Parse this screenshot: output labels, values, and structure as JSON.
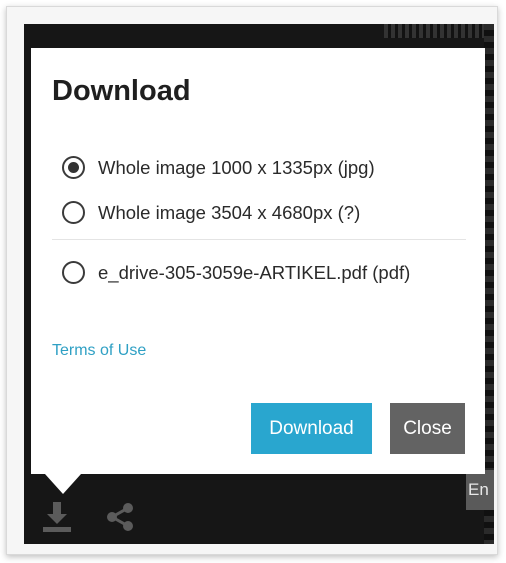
{
  "dialog": {
    "title": "Download",
    "options": [
      {
        "label": "Whole image 1000 x 1335px (jpg)",
        "checked": true
      },
      {
        "label": "Whole image 3504 x 4680px (?)",
        "checked": false
      },
      {
        "label": "e_drive-305-3059e-ARTIKEL.pdf (pdf)",
        "checked": false
      }
    ],
    "terms_link": "Terms of Use",
    "download_button": "Download",
    "close_button": "Close"
  },
  "background": {
    "side_tab_text": "En"
  },
  "toolbar": {
    "icons": [
      "download-icon",
      "share-icon"
    ]
  },
  "colors": {
    "accent": "#29a6cf",
    "link": "#2fa0c4",
    "close_button": "#636363",
    "backdrop": "#161616"
  }
}
